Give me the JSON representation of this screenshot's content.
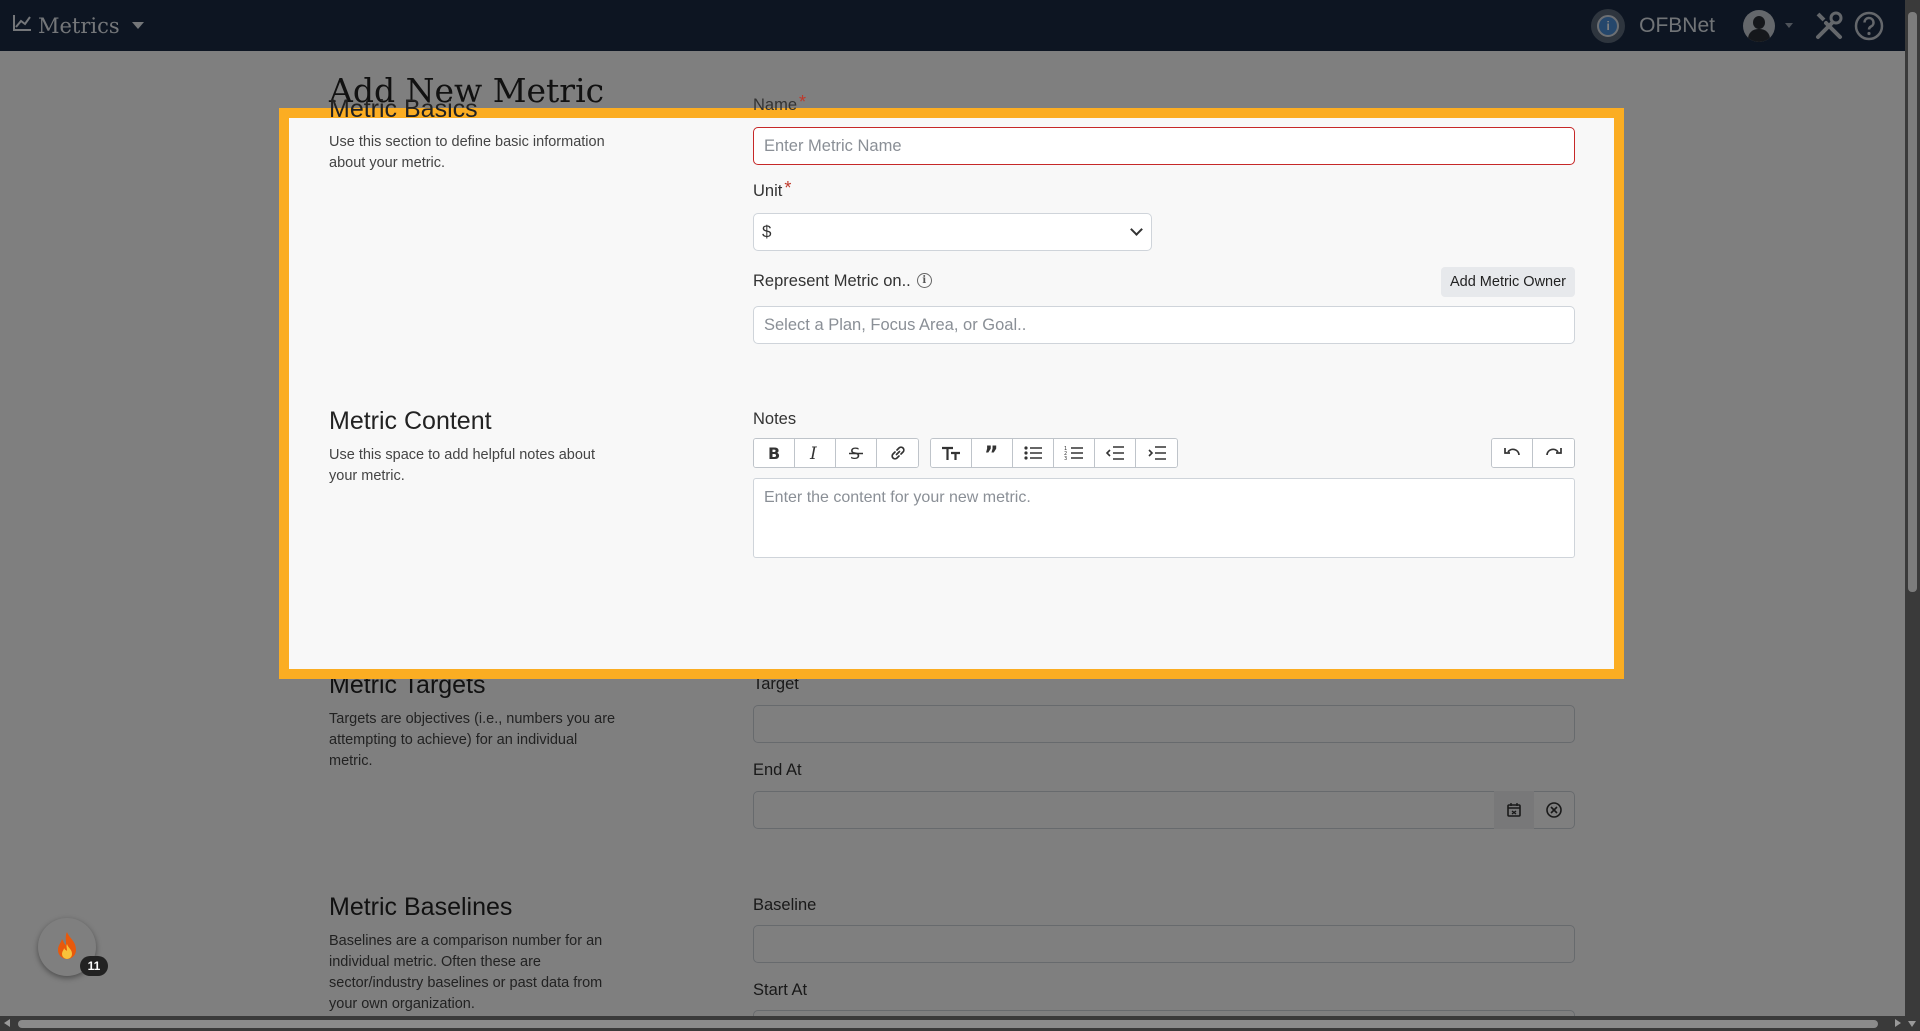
{
  "navbar": {
    "app_title": "Metrics",
    "org_name": "OFBNet",
    "org_logo_letter": "i",
    "icons": [
      "chart-line-icon",
      "caret-down-icon",
      "tools-icon",
      "help-circle-icon"
    ]
  },
  "page": {
    "title": "Add New Metric",
    "sections": {
      "basics": {
        "heading": "Metric Basics",
        "description": "Use this section to define basic information about your metric.",
        "name_label": "Name",
        "name_placeholder": "Enter Metric Name",
        "unit_label": "Unit",
        "unit_value": "$",
        "represent_label": "Represent Metric on..",
        "add_owner_label": "Add Metric Owner",
        "represent_placeholder": "Select a Plan, Focus Area, or Goal.."
      },
      "content": {
        "heading": "Metric Content",
        "description": "Use this space to add helpful notes about your metric.",
        "notes_label": "Notes",
        "editor_placeholder": "Enter the content for your new metric.",
        "toolbar_tools": [
          "bold",
          "italic",
          "strikethrough",
          "link",
          "heading",
          "quote",
          "bullet-list",
          "numbered-list",
          "outdent",
          "indent",
          "undo",
          "redo"
        ]
      },
      "targets": {
        "heading": "Metric Targets",
        "description": "Targets are objectives (i.e., numbers you are attempting to achieve) for an individual metric.",
        "target_label": "Target",
        "end_at_label": "End At"
      },
      "baselines": {
        "heading": "Metric Baselines",
        "description": "Baselines are a comparison number for an individual metric. Often these are sector/industry baselines or past data from your own organization.",
        "baseline_label": "Baseline",
        "start_at_label": "Start At"
      }
    }
  },
  "badge": {
    "count": "11"
  },
  "colors": {
    "navbar_bg": "#1a2b45",
    "highlight_border": "#fbad22",
    "required_star": "#c0392b",
    "invalid_border": "#c62828"
  }
}
